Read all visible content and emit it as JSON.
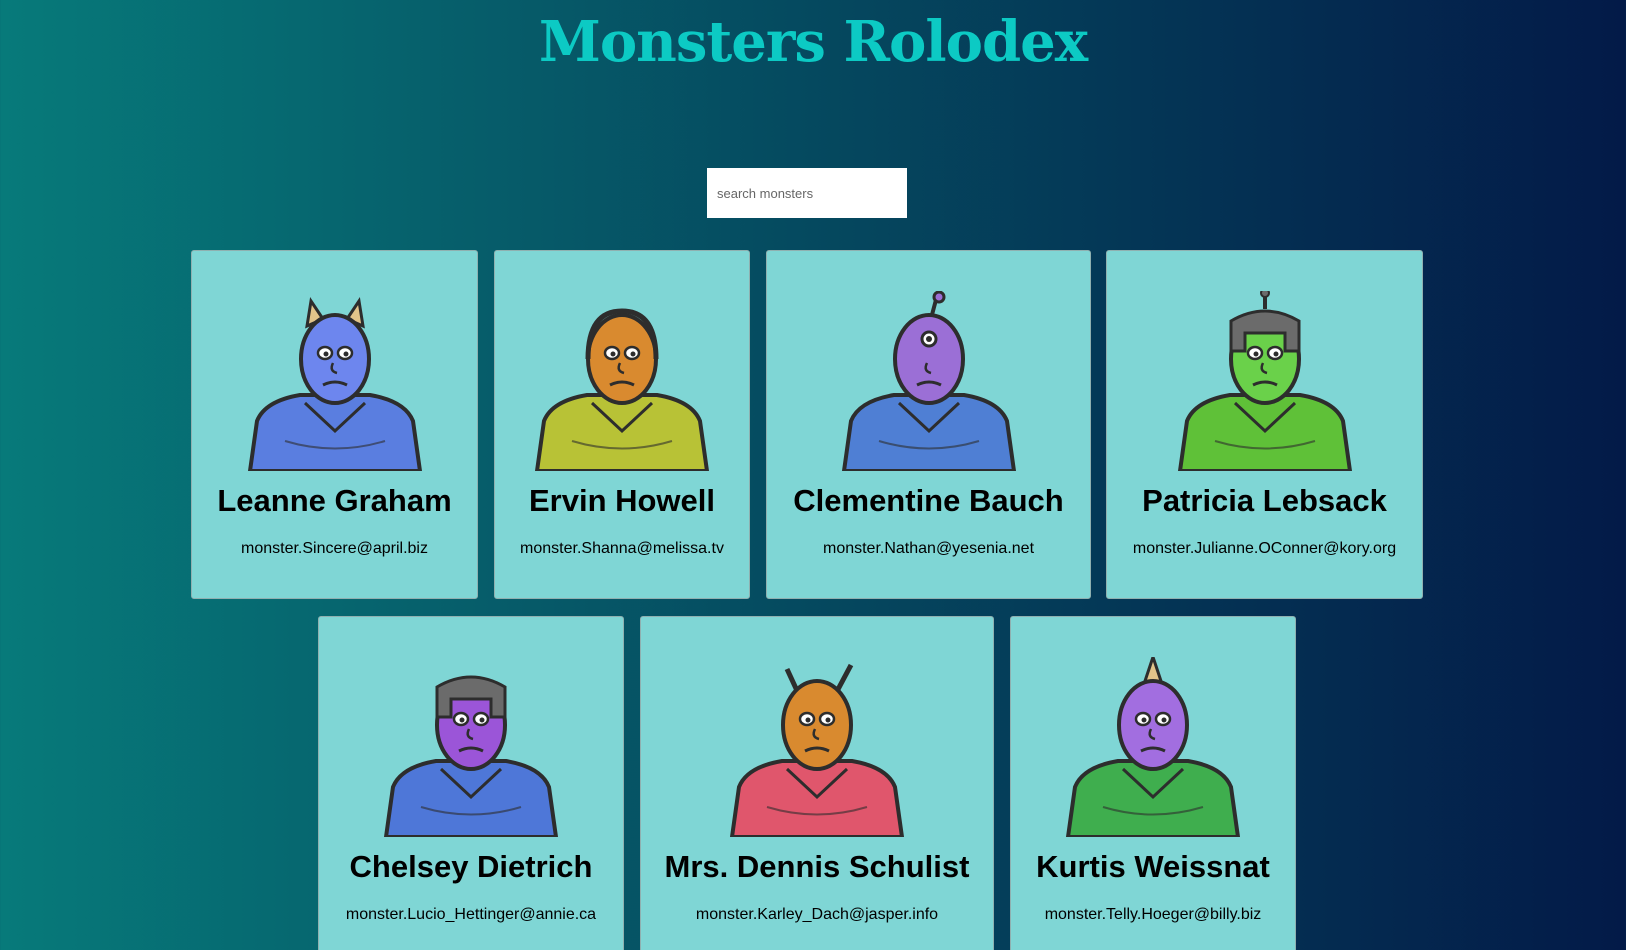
{
  "app": {
    "title": "Monsters Rolodex"
  },
  "search": {
    "placeholder": "search monsters"
  },
  "monsters": [
    {
      "name": "Leanne Graham",
      "email": "monster.Sincere@april.biz",
      "skin": "#6d86ee",
      "body": "#5a7ee0",
      "feature": "horns"
    },
    {
      "name": "Ervin Howell",
      "email": "monster.Shanna@melissa.tv",
      "skin": "#d98a2f",
      "body": "#b8c236",
      "feature": "hood"
    },
    {
      "name": "Clementine Bauch",
      "email": "monster.Nathan@yesenia.net",
      "skin": "#9b6fd6",
      "body": "#4f7fd4",
      "feature": "antenna-single"
    },
    {
      "name": "Patricia Lebsack",
      "email": "monster.Julianne.OConner@kory.org",
      "skin": "#6ad14a",
      "body": "#5fc138",
      "feature": "helmet"
    },
    {
      "name": "Chelsey Dietrich",
      "email": "monster.Lucio_Hettinger@annie.ca",
      "skin": "#9b55d8",
      "body": "#4e77d8",
      "feature": "robot-helmet"
    },
    {
      "name": "Mrs. Dennis Schulist",
      "email": "monster.Karley_Dach@jasper.info",
      "skin": "#d98a2f",
      "body": "#e0566c",
      "feature": "antennae"
    },
    {
      "name": "Kurtis Weissnat",
      "email": "monster.Telly.Hoeger@billy.biz",
      "skin": "#a26ee0",
      "body": "#3fae4e",
      "feature": "horn-single"
    }
  ]
}
